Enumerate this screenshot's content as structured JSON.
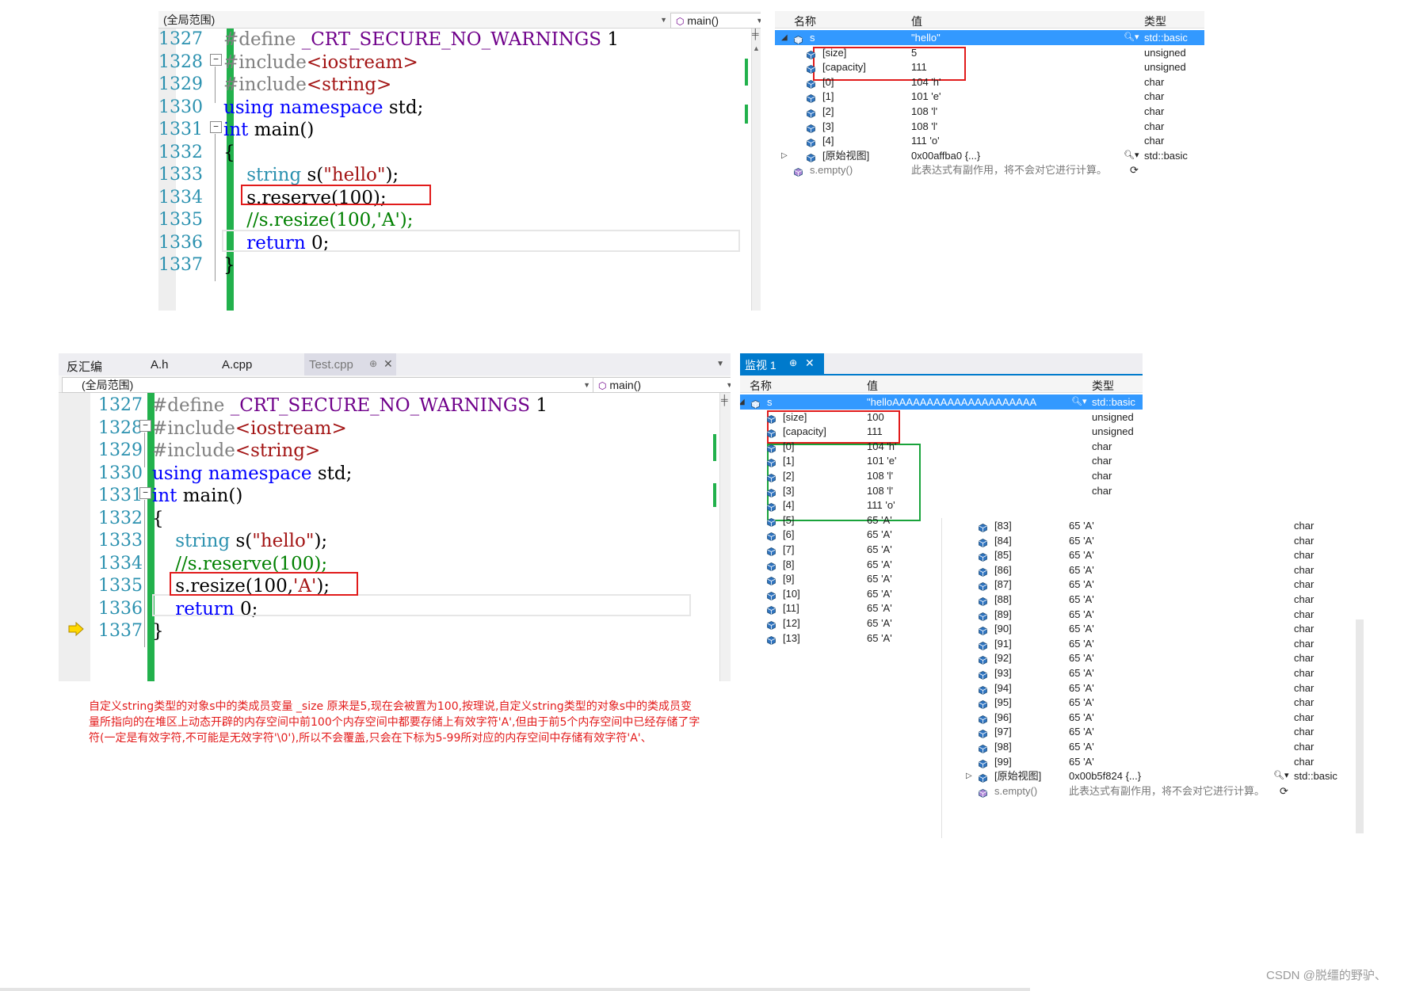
{
  "top_editor": {
    "scope": "(全局范围)",
    "func": "main()",
    "func_icon": "method-icon",
    "lines": [
      {
        "num": "1327",
        "tokens": [
          [
            "pp",
            "#define "
          ],
          [
            "macro",
            "_CRT_SECURE_NO_WARNINGS"
          ],
          [
            "plain",
            " 1"
          ]
        ]
      },
      {
        "num": "1328",
        "tokens": [
          [
            "pp",
            "#include"
          ],
          [
            "inc",
            "<iostream>"
          ]
        ]
      },
      {
        "num": "1329",
        "tokens": [
          [
            "pp",
            "#include"
          ],
          [
            "inc",
            "<string>"
          ]
        ]
      },
      {
        "num": "1330",
        "tokens": [
          [
            "kw",
            "using"
          ],
          [
            "plain",
            " "
          ],
          [
            "kw",
            "namespace"
          ],
          [
            "plain",
            " std;"
          ]
        ]
      },
      {
        "num": "1331",
        "tokens": [
          [
            "kw",
            "int"
          ],
          [
            "plain",
            " main()"
          ]
        ]
      },
      {
        "num": "1332",
        "tokens": [
          [
            "plain",
            "{"
          ]
        ]
      },
      {
        "num": "1333",
        "tokens": [
          [
            "plain",
            "    "
          ],
          [
            "type",
            "string"
          ],
          [
            "plain",
            " s("
          ],
          [
            "str",
            "\"hello\""
          ],
          [
            "plain",
            ");"
          ]
        ]
      },
      {
        "num": "1334",
        "tokens": [
          [
            "plain",
            "    s.reserve(100);"
          ]
        ]
      },
      {
        "num": "1335",
        "tokens": [
          [
            "plain",
            "    "
          ],
          [
            "cmt",
            "//s.resize(100,'A');"
          ]
        ]
      },
      {
        "num": "1336",
        "tokens": [
          [
            "plain",
            "    "
          ],
          [
            "kw",
            "return"
          ],
          [
            "plain",
            " 0;"
          ]
        ]
      },
      {
        "num": "1337",
        "tokens": [
          [
            "plain",
            "}"
          ]
        ]
      }
    ]
  },
  "top_watch": {
    "headers": {
      "name": "名称",
      "value": "值",
      "type": "类型"
    },
    "rows": [
      {
        "name": "s",
        "value": "\"hello\"",
        "type": "std::basic",
        "kind": "root"
      },
      {
        "name": "[size]",
        "value": "5",
        "type": "unsigned",
        "kind": "child"
      },
      {
        "name": "[capacity]",
        "value": "111",
        "type": "unsigned",
        "kind": "child"
      },
      {
        "name": "[0]",
        "value": "104 'h'",
        "type": "char",
        "kind": "child"
      },
      {
        "name": "[1]",
        "value": "101 'e'",
        "type": "char",
        "kind": "child"
      },
      {
        "name": "[2]",
        "value": "108 'l'",
        "type": "char",
        "kind": "child"
      },
      {
        "name": "[3]",
        "value": "108 'l'",
        "type": "char",
        "kind": "child"
      },
      {
        "name": "[4]",
        "value": "111 'o'",
        "type": "char",
        "kind": "child"
      },
      {
        "name": "[原始视图]",
        "value": "0x00affba0 {...}",
        "type": "std::basic",
        "kind": "raw"
      },
      {
        "name": "s.empty()",
        "value": "此表达式有副作用，将不会对它进行计算。",
        "type": "",
        "kind": "method"
      }
    ]
  },
  "bottom_tabs": [
    "反汇编",
    "A.h",
    "A.cpp",
    "Test.cpp"
  ],
  "pin_glyph": "⊕",
  "close_glyph": "✕",
  "bottom_editor": {
    "scope": "(全局范围)",
    "func": "main()",
    "lines": [
      {
        "num": "1327",
        "tokens": [
          [
            "pp",
            "#define "
          ],
          [
            "macro",
            "_CRT_SECURE_NO_WARNINGS"
          ],
          [
            "plain",
            " 1"
          ]
        ]
      },
      {
        "num": "1328",
        "tokens": [
          [
            "pp",
            "#include"
          ],
          [
            "inc",
            "<iostream>"
          ]
        ]
      },
      {
        "num": "1329",
        "tokens": [
          [
            "pp",
            "#include"
          ],
          [
            "inc",
            "<string>"
          ]
        ]
      },
      {
        "num": "1330",
        "tokens": [
          [
            "kw",
            "using"
          ],
          [
            "plain",
            " "
          ],
          [
            "kw",
            "namespace"
          ],
          [
            "plain",
            " std;"
          ]
        ]
      },
      {
        "num": "1331",
        "tokens": [
          [
            "kw",
            "int"
          ],
          [
            "plain",
            " main()"
          ]
        ]
      },
      {
        "num": "1332",
        "tokens": [
          [
            "plain",
            "{"
          ]
        ]
      },
      {
        "num": "1333",
        "tokens": [
          [
            "plain",
            "    "
          ],
          [
            "type",
            "string"
          ],
          [
            "plain",
            " s("
          ],
          [
            "str",
            "\"hello\""
          ],
          [
            "plain",
            ");"
          ]
        ]
      },
      {
        "num": "1334",
        "tokens": [
          [
            "plain",
            "    "
          ],
          [
            "cmt",
            "//s.reserve(100);"
          ]
        ]
      },
      {
        "num": "1335",
        "tokens": [
          [
            "plain",
            "    s.resize(100,"
          ],
          [
            "str",
            "'A'"
          ],
          [
            "plain",
            ");"
          ]
        ]
      },
      {
        "num": "1336",
        "tokens": [
          [
            "plain",
            "    "
          ],
          [
            "kw",
            "return"
          ],
          [
            "plain",
            " 0;"
          ]
        ]
      },
      {
        "num": "1337",
        "tokens": [
          [
            "plain",
            "}"
          ]
        ]
      }
    ]
  },
  "bottom_watch": {
    "tab": "监视 1",
    "headers": {
      "name": "名称",
      "value": "值",
      "type": "类型"
    },
    "rows": [
      {
        "name": "s",
        "value": "\"helloAAAAAAAAAAAAAAAAAAAAA",
        "type": "std::basic",
        "kind": "root"
      },
      {
        "name": "[size]",
        "value": "100",
        "type": "unsigned",
        "kind": "child"
      },
      {
        "name": "[capacity]",
        "value": "111",
        "type": "unsigned",
        "kind": "child"
      },
      {
        "name": "[0]",
        "value": "104 'h'",
        "type": "char",
        "kind": "child"
      },
      {
        "name": "[1]",
        "value": "101 'e'",
        "type": "char",
        "kind": "child"
      },
      {
        "name": "[2]",
        "value": "108 'l'",
        "type": "char",
        "kind": "child"
      },
      {
        "name": "[3]",
        "value": "108 'l'",
        "type": "char",
        "kind": "child"
      },
      {
        "name": "[4]",
        "value": "111 'o'",
        "type": "",
        "kind": "child"
      },
      {
        "name": "[5]",
        "value": "65 'A'",
        "type": "",
        "kind": "child"
      },
      {
        "name": "[6]",
        "value": "65 'A'",
        "type": "",
        "kind": "child"
      },
      {
        "name": "[7]",
        "value": "65 'A'",
        "type": "",
        "kind": "child"
      },
      {
        "name": "[8]",
        "value": "65 'A'",
        "type": "",
        "kind": "child"
      },
      {
        "name": "[9]",
        "value": "65 'A'",
        "type": "",
        "kind": "child"
      },
      {
        "name": "[10]",
        "value": "65 'A'",
        "type": "",
        "kind": "child"
      },
      {
        "name": "[11]",
        "value": "65 'A'",
        "type": "",
        "kind": "child"
      },
      {
        "name": "[12]",
        "value": "65 'A'",
        "type": "",
        "kind": "child"
      },
      {
        "name": "[13]",
        "value": "65 'A'",
        "type": "",
        "kind": "child"
      }
    ]
  },
  "overlay_watch": {
    "rows": [
      {
        "name": "[83]",
        "value": "65 'A'",
        "type": "char",
        "kind": "child"
      },
      {
        "name": "[84]",
        "value": "65 'A'",
        "type": "char",
        "kind": "child"
      },
      {
        "name": "[85]",
        "value": "65 'A'",
        "type": "char",
        "kind": "child"
      },
      {
        "name": "[86]",
        "value": "65 'A'",
        "type": "char",
        "kind": "child"
      },
      {
        "name": "[87]",
        "value": "65 'A'",
        "type": "char",
        "kind": "child"
      },
      {
        "name": "[88]",
        "value": "65 'A'",
        "type": "char",
        "kind": "child"
      },
      {
        "name": "[89]",
        "value": "65 'A'",
        "type": "char",
        "kind": "child"
      },
      {
        "name": "[90]",
        "value": "65 'A'",
        "type": "char",
        "kind": "child"
      },
      {
        "name": "[91]",
        "value": "65 'A'",
        "type": "char",
        "kind": "child"
      },
      {
        "name": "[92]",
        "value": "65 'A'",
        "type": "char",
        "kind": "child"
      },
      {
        "name": "[93]",
        "value": "65 'A'",
        "type": "char",
        "kind": "child"
      },
      {
        "name": "[94]",
        "value": "65 'A'",
        "type": "char",
        "kind": "child"
      },
      {
        "name": "[95]",
        "value": "65 'A'",
        "type": "char",
        "kind": "child"
      },
      {
        "name": "[96]",
        "value": "65 'A'",
        "type": "char",
        "kind": "child"
      },
      {
        "name": "[97]",
        "value": "65 'A'",
        "type": "char",
        "kind": "child"
      },
      {
        "name": "[98]",
        "value": "65 'A'",
        "type": "char",
        "kind": "child"
      },
      {
        "name": "[99]",
        "value": "65 'A'",
        "type": "char",
        "kind": "child"
      },
      {
        "name": "[原始视图]",
        "value": "0x00b5f824 {...}",
        "type": "std::basic",
        "kind": "raw"
      },
      {
        "name": "s.empty()",
        "value": "此表达式有副作用，将不会对它进行计算。",
        "type": "",
        "kind": "method"
      }
    ]
  },
  "note": {
    "lines": [
      "自定义string类型的对象s中的类成员变量 _size 原来是5,现在会被置为100,按理说,自定义string类型的对象s中的类成员变",
      "量所指向的在堆区上动态开辟的内存空间中前100个内存空间中都要存储上有效字符'A',但由于前5个内存空间中已经存储了字",
      "符(一定是有效字符,不可能是无效字符'\\0'),所以不会覆盖,只会在下标为5-99所对应的内存空间中存储有效字符'A'、"
    ]
  },
  "watermark": "CSDN @脱缰的野驴、",
  "colors": {
    "accent": "#007acc",
    "selection": "#3399ff",
    "red_box": "#e11b1b",
    "green_box": "#19a33b",
    "line_number": "#2b91af"
  }
}
